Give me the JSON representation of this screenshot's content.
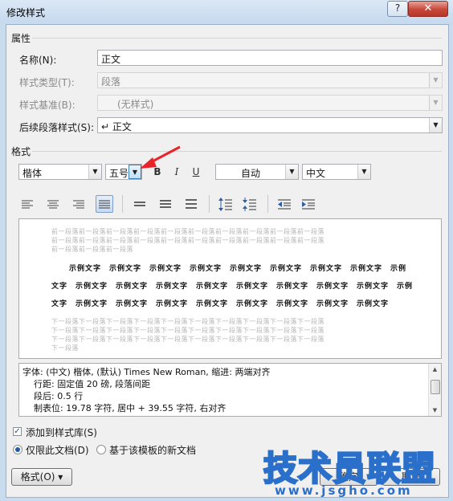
{
  "window": {
    "title": "修改样式",
    "help": "?",
    "close": "✕"
  },
  "properties": {
    "section_title": "属性",
    "name_label": "名称(N):",
    "name_value": "正文",
    "style_type_label": "样式类型(T):",
    "style_type_value": "段落",
    "style_based_label": "样式基准(B):",
    "style_based_value": "(无样式)",
    "next_style_label": "后续段落样式(S):",
    "next_style_value": "↵ 正文"
  },
  "format": {
    "section_title": "格式",
    "font": "楷体",
    "size": "五号",
    "bold": "B",
    "italic": "I",
    "underline": "U",
    "color": "自动",
    "script": "中文"
  },
  "preview": {
    "prev_lines": [
      "前一段落前一段落前一段落前一段落前一段落前一段落前一段落前一段落前一段落前一段落",
      "前一段落前一段落前一段落前一段落前一段落前一段落前一段落前一段落前一段落前一段落",
      "前一段落前一段落前一段落"
    ],
    "sample_lines": [
      "示例文字　示例文字　示例文字　示例文字　示例文字　示例文字　示例文字　示例文字　示例",
      "文字　示例文字　示例文字　示例文字　示例文字　示例文字　示例文字　示例文字　示例文字　示例",
      "文字　示例文字　示例文字　示例文字　示例文字　示例文字　示例文字　示例文字　示例文字"
    ],
    "next_lines": [
      "下一段落下一段落下一段落下一段落下一段落下一段落下一段落下一段落下一段落下一段落",
      "下一段落下一段落下一段落下一段落下一段落下一段落下一段落下一段落下一段落下一段落",
      "下一段落下一段落下一段落下一段落下一段落下一段落下一段落下一段落下一段落下一段落",
      "下一段落"
    ]
  },
  "description": {
    "lines": [
      "字体: (中文) 楷体, (默认) Times New Roman, 缩进: 两端对齐",
      "行距: 固定值 20 磅, 段落间距",
      "段后: 0.5 行",
      "制表位: 19.78 字符, 居中 +  39.55 字符, 右对齐"
    ]
  },
  "options": {
    "add_to_gallery": "添加到样式库(S)",
    "this_doc_only": "仅限此文档(D)",
    "new_docs_template": "基于该模板的新文档"
  },
  "buttons": {
    "format": "格式(O) ▾",
    "ok": "确定",
    "cancel": "取消"
  },
  "watermark": {
    "text": "技术员联盟",
    "url": "www.jsgho.com"
  },
  "colors": {
    "accent": "#2a6fc9",
    "annotation_arrow": "#e8232a"
  }
}
